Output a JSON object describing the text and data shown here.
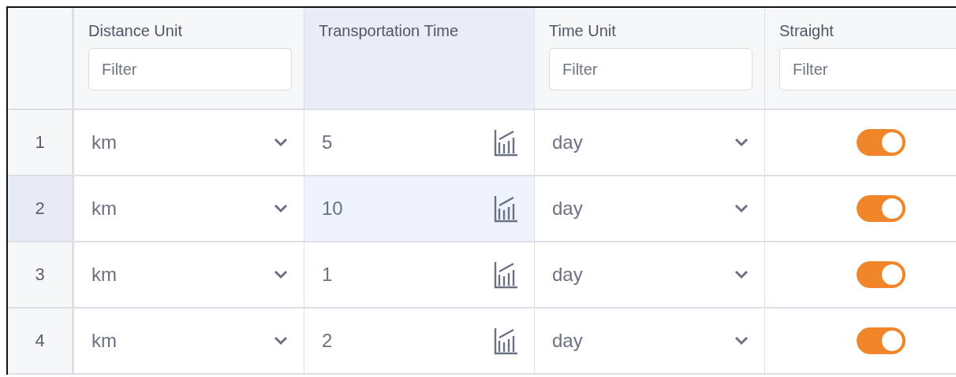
{
  "columns": [
    {
      "label": "Distance Unit",
      "filter_placeholder": "Filter",
      "selected": false
    },
    {
      "label": "Transportation Time",
      "selected": true
    },
    {
      "label": "Time Unit",
      "filter_placeholder": "Filter",
      "selected": false
    },
    {
      "label": "Straight",
      "filter_placeholder": "Filter",
      "selected": false
    }
  ],
  "rows": [
    {
      "number": "1",
      "distance_unit": "km",
      "transportation_time": "5",
      "time_unit": "day",
      "straight": true,
      "selected": false
    },
    {
      "number": "2",
      "distance_unit": "km",
      "transportation_time": "10",
      "time_unit": "day",
      "straight": true,
      "selected": true
    },
    {
      "number": "3",
      "distance_unit": "km",
      "transportation_time": "1",
      "time_unit": "day",
      "straight": true,
      "selected": false
    },
    {
      "number": "4",
      "distance_unit": "km",
      "transportation_time": "2",
      "time_unit": "day",
      "straight": true,
      "selected": false
    }
  ]
}
